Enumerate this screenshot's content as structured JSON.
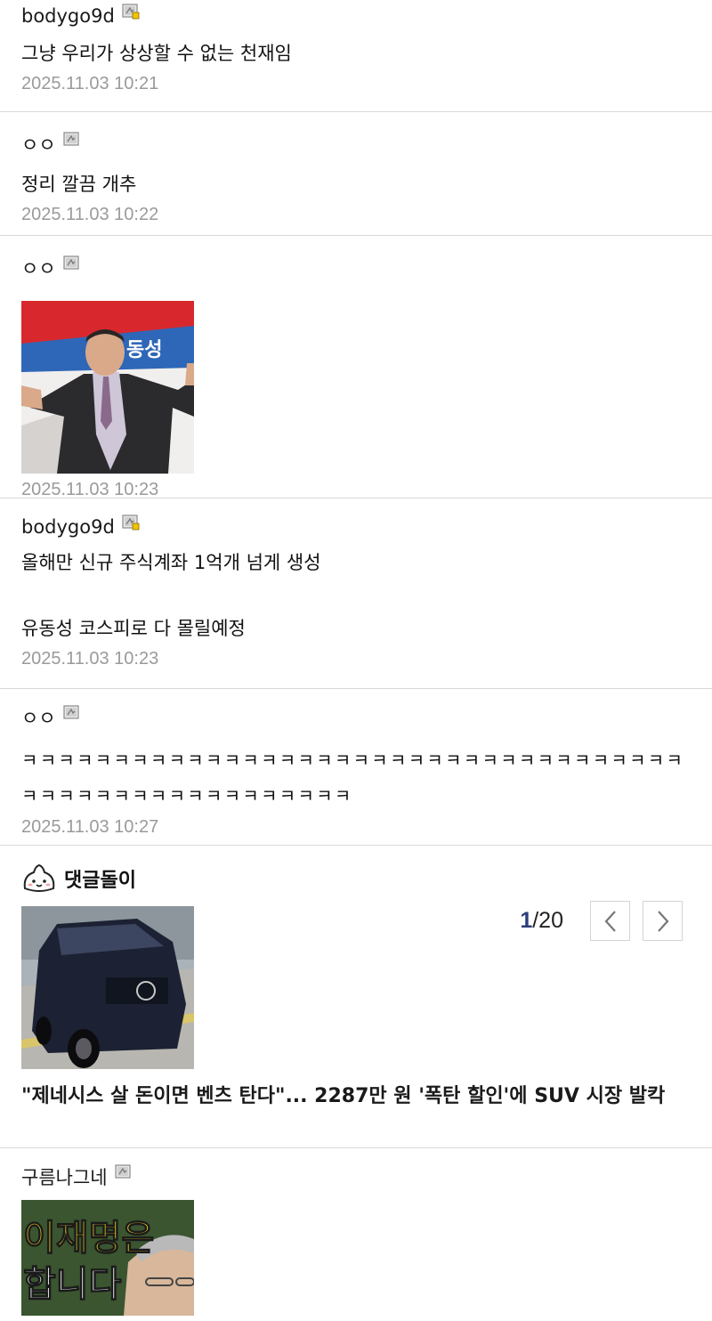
{
  "comments": [
    {
      "nick": "bodygo9d",
      "text": "그냥 우리가 상상할 수 없는 천재임",
      "date": "2025.11.03 10:21"
    },
    {
      "nick": "ㅇㅇ",
      "text": "정리 깔끔 개추",
      "date": "2025.11.03 10:22"
    },
    {
      "nick": "ㅇㅇ",
      "date": "2025.11.03 10:23"
    },
    {
      "nick": "bodygo9d",
      "text": "올해만 신규 주식계좌 1억개 넘게 생성\n\n유동성 코스피로 다 몰릴예정",
      "date": "2025.11.03 10:23"
    },
    {
      "nick": "ㅇㅇ",
      "text": "ㅋㅋㅋㅋㅋㅋㅋㅋㅋㅋㅋㅋㅋㅋㅋㅋㅋㅋㅋㅋㅋㅋㅋㅋㅋㅋㅋㅋㅋㅋㅋㅋㅋㅋㅋㅋㅋㅋㅋㅋㅋㅋㅋㅋㅋㅋㅋㅋㅋㅋㅋㅋㅋㅋ",
      "date": "2025.11.03 10:27"
    },
    {
      "nick": "구름나그네"
    }
  ],
  "bot": {
    "title": "댓글돌이",
    "page_current": "1",
    "page_total": "/20",
    "news_title": "\"제네시스 살 돈이면 벤츠 탄다\"... 2287만 원 '폭탄 할인'에 SUV 시장 발칵"
  },
  "last_image_text": {
    "line1": "이재명은",
    "line2": "합니다"
  },
  "colors": {
    "date": "#9a9a9a",
    "divider": "#d9d9d9",
    "pager_current": "#2d3e7a"
  }
}
